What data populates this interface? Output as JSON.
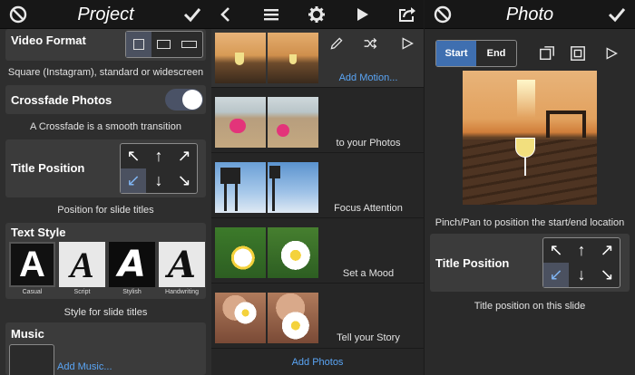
{
  "project": {
    "title": "Project",
    "video_format_label": "Video Format",
    "video_format_caption": "Square (Instagram), standard or widescreen",
    "crossfade_label": "Crossfade Photos",
    "crossfade_caption": "A Crossfade is a smooth transition",
    "crossfade_on": true,
    "title_position_label": "Title Position",
    "title_position_caption": "Position for slide titles",
    "text_style_label": "Text Style",
    "text_styles": [
      "Casual",
      "Script",
      "Stylish",
      "Handwriting"
    ],
    "text_style_caption": "Style for slide titles",
    "music_label": "Music",
    "add_music": "Add Music..."
  },
  "slides": {
    "add_motion": "Add Motion...",
    "rows": [
      "to your Photos",
      "Focus Attention",
      "Set a Mood",
      "Tell your Story"
    ],
    "add_photos": "Add Photos"
  },
  "photo": {
    "title": "Photo",
    "start": "Start",
    "end": "End",
    "pinch_caption": "Pinch/Pan to position the start/end location",
    "title_position_label": "Title Position",
    "title_position_caption": "Title position on this slide"
  },
  "icons": {
    "title_position_grid": [
      "↖",
      "↑",
      "↗",
      "↙",
      "↓",
      "↘"
    ],
    "title_position_selected": 3
  },
  "colors": {
    "accent": "#5aa5f5",
    "selected": "#4b5160"
  }
}
